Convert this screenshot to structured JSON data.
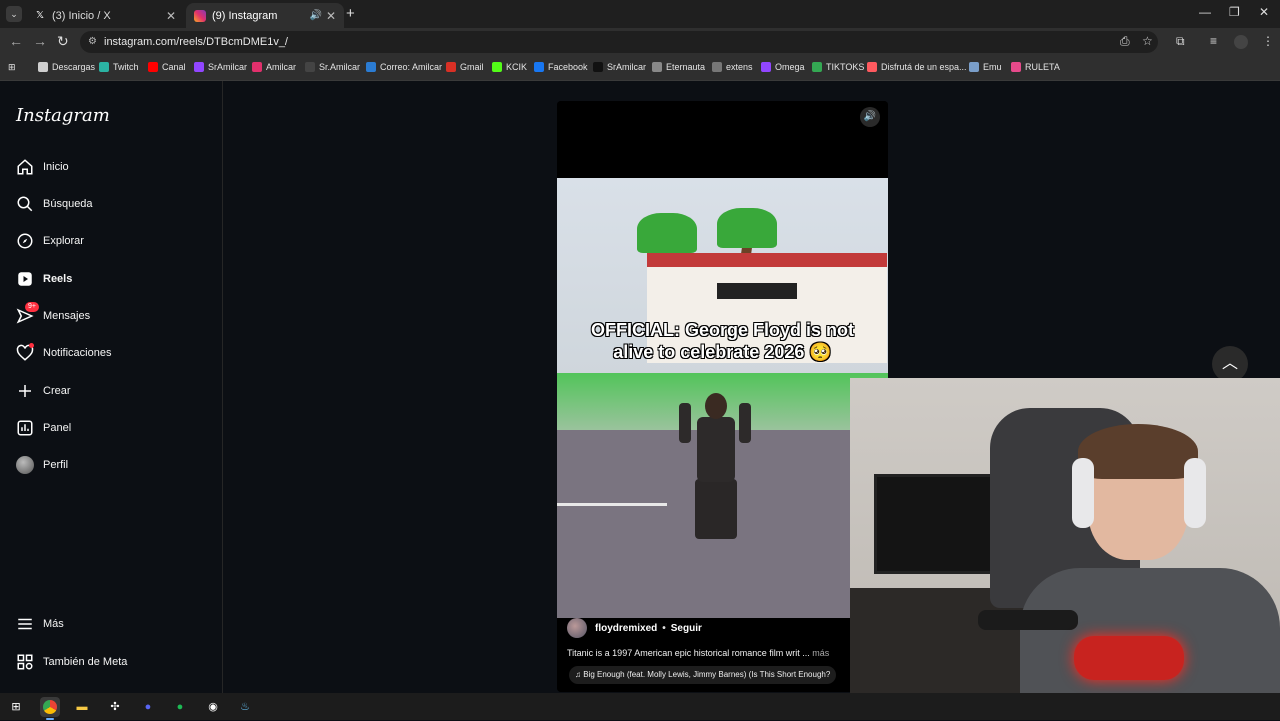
{
  "browser": {
    "tabs": [
      {
        "title": "(3) Inicio / X",
        "icon": "x-logo-icon"
      },
      {
        "title": "(9) Instagram",
        "icon": "instagram-icon",
        "active": true
      }
    ],
    "url": "instagram.com/reels/DTBcmDME1v_/",
    "bookmarks": [
      {
        "label": "Descargas",
        "icon": "download-icon",
        "color": "#cfcfcf"
      },
      {
        "label": "Twitch",
        "icon": "twitch-icon",
        "color": "#2bb3a3"
      },
      {
        "label": "Canal",
        "icon": "youtube-icon",
        "color": "#ff0000"
      },
      {
        "label": "SrAmilcar",
        "icon": "twitch-icon",
        "color": "#9146ff"
      },
      {
        "label": "Amilcar",
        "icon": "instagram-icon",
        "color": "#e1306c"
      },
      {
        "label": "Sr.Amilcar",
        "icon": "x-logo-icon",
        "color": "#444444"
      },
      {
        "label": "Correo: Amilcar",
        "icon": "outlook-icon",
        "color": "#2b7cd3"
      },
      {
        "label": "Gmail",
        "icon": "gmail-icon",
        "color": "#d93025"
      },
      {
        "label": "KCIK",
        "icon": "kick-icon",
        "color": "#53fc18"
      },
      {
        "label": "Facebook",
        "icon": "facebook-icon",
        "color": "#1877f2"
      },
      {
        "label": "SrAmilcar",
        "icon": "tiktok-icon",
        "color": "#111111"
      },
      {
        "label": "Eternauta",
        "icon": "document-icon",
        "color": "#888888"
      },
      {
        "label": "extens",
        "icon": "extension-icon",
        "color": "#777777"
      },
      {
        "label": "Omega",
        "icon": "twitch-icon",
        "color": "#9146ff"
      },
      {
        "label": "TIKTOKS",
        "icon": "drive-icon",
        "color": "#34a853"
      },
      {
        "label": "Disfrutá de un espa...",
        "icon": "airbnb-icon",
        "color": "#ff5a5f"
      },
      {
        "label": "Emu",
        "icon": "emulator-icon",
        "color": "#7a9ec9"
      },
      {
        "label": "RULETA",
        "icon": "wheel-icon",
        "color": "#e64a8b"
      }
    ]
  },
  "sidebar": {
    "logo": "Instagram",
    "items": [
      {
        "label": "Inicio",
        "icon": "home-icon"
      },
      {
        "label": "Búsqueda",
        "icon": "search-icon"
      },
      {
        "label": "Explorar",
        "icon": "compass-icon"
      },
      {
        "label": "Reels",
        "icon": "reels-icon",
        "active": true
      },
      {
        "label": "Mensajes",
        "icon": "messenger-icon",
        "badge": "9+"
      },
      {
        "label": "Notificaciones",
        "icon": "heart-icon",
        "dot": true
      },
      {
        "label": "Crear",
        "icon": "plus-icon"
      },
      {
        "label": "Panel",
        "icon": "chart-icon"
      },
      {
        "label": "Perfil",
        "icon": "avatar-icon"
      }
    ],
    "bottom": [
      {
        "label": "Más",
        "icon": "menu-icon"
      },
      {
        "label": "También de Meta",
        "icon": "meta-icon"
      }
    ]
  },
  "reel": {
    "caption_overlay_line1": "OFFICIAL: George Floyd is not",
    "caption_overlay_line2": "alive to celebrate 2026 🥺",
    "author": "floydremixed",
    "separator": "•",
    "follow": "Seguir",
    "description": "Titanic is a 1997 American epic historical romance film writ ...",
    "more": "más",
    "music": "Big Enough (feat. Molly Lewis, Jimmy Barnes) (Is This Short Enough?"
  },
  "colors": {
    "page_bg": "#0c0f14",
    "notification_red": "#ff3040"
  }
}
